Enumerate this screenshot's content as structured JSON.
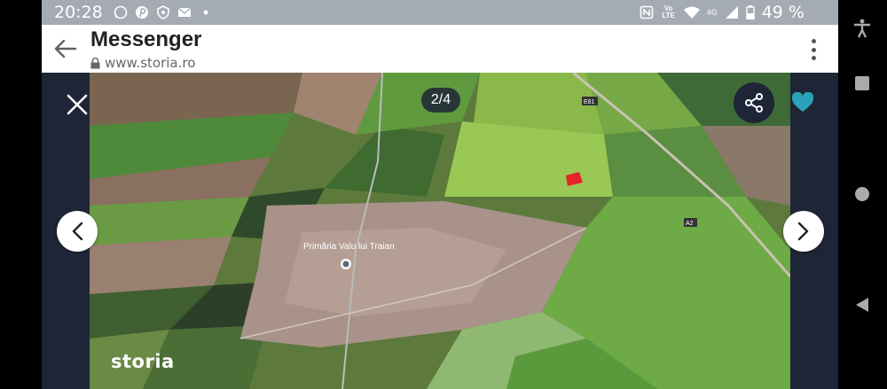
{
  "status_bar": {
    "time": "20:28",
    "left_icons": [
      "whatsapp-icon",
      "pinterest-icon",
      "shield-icon",
      "email-icon",
      "dot-icon"
    ],
    "right_icons": [
      "nfc-icon",
      "volte-icon",
      "wifi-icon",
      "signal-icon",
      "battery-icon"
    ],
    "volte_label": "Vo LTE",
    "network_label": "4G",
    "battery": "49 %"
  },
  "browser": {
    "title": "Messenger",
    "url": "www.storia.ro"
  },
  "gallery": {
    "counter": "2/4",
    "watermark": "storia",
    "favorite_color": "#2aa3b8",
    "map_labels": {
      "place": "Primăria Valu lui Traian",
      "road_e81": "E81",
      "road_a2": "A2"
    }
  },
  "android_nav": [
    "accessibility-icon",
    "recents-icon",
    "home-icon",
    "back-icon"
  ]
}
